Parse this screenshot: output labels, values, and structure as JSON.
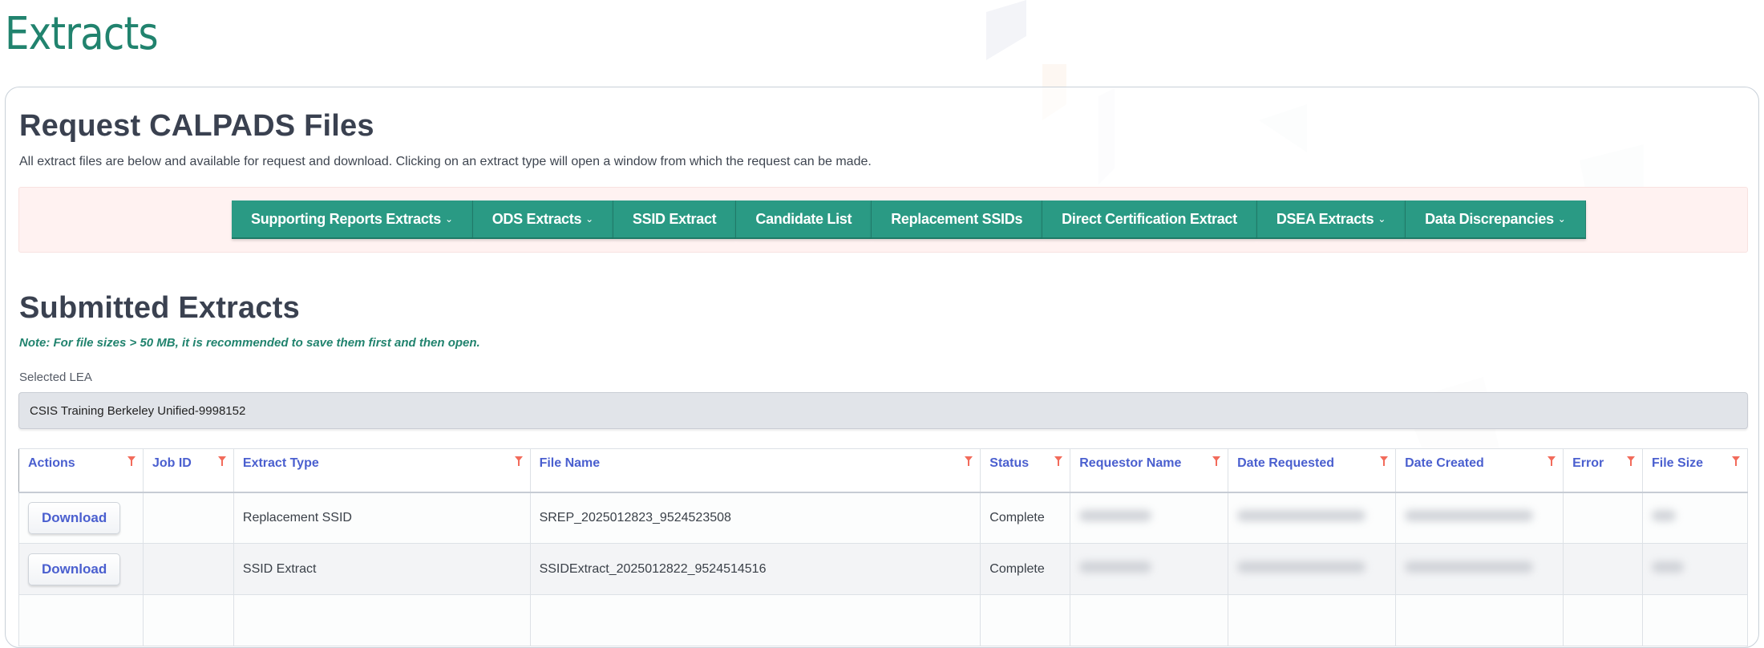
{
  "page": {
    "title": "Extracts"
  },
  "request_section": {
    "title": "Request CALPADS Files",
    "description": "All extract files are below and available for request and download. Clicking on an extract type will open a window from which the request can be made.",
    "buttons": [
      {
        "label": "Supporting Reports Extracts",
        "dropdown": true
      },
      {
        "label": "ODS Extracts",
        "dropdown": true
      },
      {
        "label": "SSID Extract",
        "dropdown": false
      },
      {
        "label": "Candidate List",
        "dropdown": false
      },
      {
        "label": "Replacement SSIDs",
        "dropdown": false
      },
      {
        "label": "Direct Certification Extract",
        "dropdown": false
      },
      {
        "label": "DSEA Extracts",
        "dropdown": true
      },
      {
        "label": "Data Discrepancies",
        "dropdown": true
      }
    ],
    "chevron": "⌄"
  },
  "submitted_section": {
    "title": "Submitted Extracts",
    "note": "Note: For file sizes > 50 MB, it is recommended to save them first and then open.",
    "lea_label": "Selected LEA",
    "lea_value": "CSIS Training Berkeley Unified-9998152"
  },
  "table": {
    "columns": [
      "Actions",
      "Job ID",
      "Extract Type",
      "File Name",
      "Status",
      "Requestor Name",
      "Date Requested",
      "Date Created",
      "Error",
      "File Size"
    ],
    "rows": [
      {
        "action": "Download",
        "job_id": "",
        "extract_type": "Replacement SSID",
        "file_name": "SREP_2025012823_9524523508",
        "status": "Complete",
        "requestor_name": "[redacted]",
        "date_requested": "[redacted]",
        "date_created": "[redacted]",
        "error": "",
        "file_size": "[redacted]"
      },
      {
        "action": "Download",
        "job_id": "",
        "extract_type": "SSID Extract",
        "file_name": "SSIDExtract_2025012822_9524514516",
        "status": "Complete",
        "requestor_name": "[redacted]",
        "date_requested": "[redacted]",
        "date_created": "[redacted]",
        "error": "",
        "file_size": "[redacted]"
      }
    ]
  },
  "colors": {
    "brand_green": "#21836e",
    "button_green": "#2a9a84",
    "header_blue": "#4a5fcf",
    "filter_red": "#f26b5b"
  }
}
